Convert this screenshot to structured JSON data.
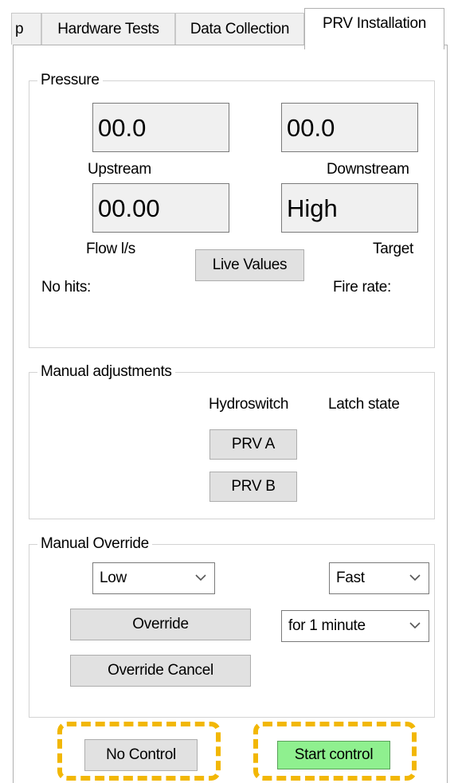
{
  "tabs": [
    {
      "label": "p"
    },
    {
      "label": "Hardware Tests"
    },
    {
      "label": "Data Collection"
    },
    {
      "label": "PRV Installation"
    }
  ],
  "pressure": {
    "title": "Pressure",
    "upstream_value": "00.0",
    "downstream_value": "00.0",
    "upstream_label": "Upstream",
    "downstream_label": "Downstream",
    "flow_value": "00.00",
    "target_value": "High",
    "flow_label": "Flow l/s",
    "target_label": "Target",
    "live_values_button": "Live Values",
    "no_hits_label": "No hits:",
    "fire_rate_label": "Fire rate:"
  },
  "manual_adjustments": {
    "title": "Manual adjustments",
    "hydroswitch_label": "Hydroswitch",
    "latch_state_label": "Latch state",
    "prv_a_button": "PRV A",
    "prv_b_button": "PRV B"
  },
  "manual_override": {
    "title": "Manual Override",
    "level_select": "Low",
    "speed_select": "Fast",
    "override_button": "Override",
    "duration_select": "for 1 minute",
    "override_cancel_button": "Override Cancel"
  },
  "footer": {
    "no_control_button": "No Control",
    "start_control_button": "Start control"
  },
  "colors": {
    "highlight": "#f2b705",
    "start_control_bg": "#8ff08f"
  }
}
